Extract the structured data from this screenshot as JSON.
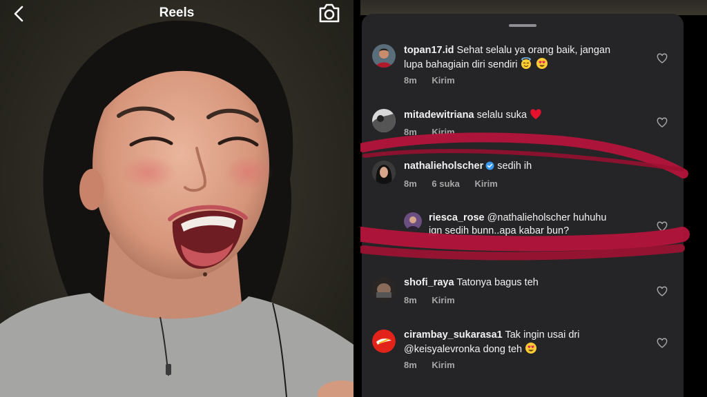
{
  "reels": {
    "title": "Reels",
    "back_icon": "chevron-left-icon",
    "camera_icon": "camera-icon"
  },
  "comments": [
    {
      "username": "topan17.id",
      "line1": "Sehat selalu ya orang baik, jangan",
      "line2": "lupa bahagiain diri sendiri",
      "emojis": [
        "smiling-face-with-halo",
        "smiling-face-with-heart-eyes"
      ],
      "time": "8m",
      "reply_label": "Kirim"
    },
    {
      "username": "mitadewitriana",
      "line1": "selalu suka",
      "emojis": [
        "red-heart"
      ],
      "time": "8m",
      "reply_label": "Kirim"
    },
    {
      "username": "nathalieholscher",
      "verified": true,
      "line1": "sedih ih",
      "time": "8m",
      "likes": "6 suka",
      "reply_label": "Kirim"
    },
    {
      "username": "riesca_rose",
      "is_reply": true,
      "line1": "@nathalieholscher huhuhu",
      "line2": "jgn sedih bunn..apa kabar bun?"
    },
    {
      "username": "shofi_raya",
      "line1": "Tatonya bagus teh",
      "time": "8m",
      "reply_label": "Kirim"
    },
    {
      "username": "cirambay_sukarasa1",
      "line1": "Tak ingin usai dri",
      "line2": "@keisyalevronka dong teh",
      "emojis": [
        "smiling-face-with-heart-eyes"
      ],
      "time": "8m",
      "reply_label": "Kirim"
    }
  ],
  "colors": {
    "sheet_bg": "#252527",
    "text": "#f2f2f2",
    "meta": "#a8a8a8",
    "highlight": "#b3143a",
    "verified": "#3897f0"
  }
}
